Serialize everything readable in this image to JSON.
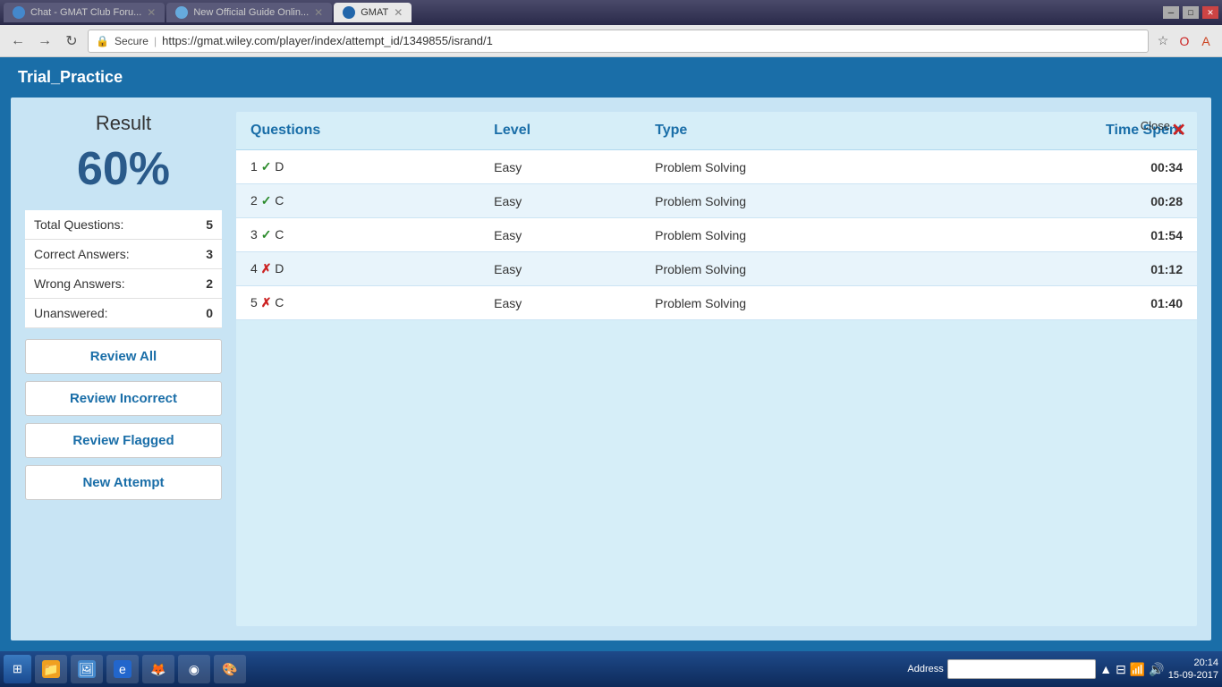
{
  "browser": {
    "tabs": [
      {
        "label": "Chat - GMAT Club Foru...",
        "active": false,
        "id": "tab-chat"
      },
      {
        "label": "New Official Guide Onlin...",
        "active": false,
        "id": "tab-og"
      },
      {
        "label": "GMAT",
        "active": true,
        "id": "tab-gmat"
      }
    ],
    "url": "https://gmat.wiley.com/player/index/attempt_id/1349855/isrand/1",
    "secure_label": "Secure"
  },
  "page": {
    "title": "Trial_Practice"
  },
  "result": {
    "label": "Result",
    "percentage": "60%"
  },
  "stats": [
    {
      "label": "Total Questions:",
      "value": "5"
    },
    {
      "label": "Correct Answers:",
      "value": "3"
    },
    {
      "label": "Wrong Answers:",
      "value": "2"
    },
    {
      "label": "Unanswered:",
      "value": "0"
    }
  ],
  "buttons": [
    {
      "label": "Review All",
      "id": "review-all"
    },
    {
      "label": "Review Incorrect",
      "id": "review-incorrect"
    },
    {
      "label": "Review Flagged",
      "id": "review-flagged"
    },
    {
      "label": "New Attempt",
      "id": "new-attempt"
    }
  ],
  "table": {
    "headers": [
      "Questions",
      "Level",
      "Type",
      "Time Spent"
    ],
    "close_label": "Close",
    "rows": [
      {
        "num": "1",
        "correct": true,
        "answer": "D",
        "level": "Easy",
        "type": "Problem Solving",
        "time": "00:34"
      },
      {
        "num": "2",
        "correct": true,
        "answer": "C",
        "level": "Easy",
        "type": "Problem Solving",
        "time": "00:28"
      },
      {
        "num": "3",
        "correct": true,
        "answer": "C",
        "level": "Easy",
        "type": "Problem Solving",
        "time": "01:54"
      },
      {
        "num": "4",
        "correct": false,
        "answer": "D",
        "level": "Easy",
        "type": "Problem Solving",
        "time": "01:12"
      },
      {
        "num": "5",
        "correct": false,
        "answer": "C",
        "level": "Easy",
        "type": "Problem Solving",
        "time": "01:40"
      }
    ]
  },
  "taskbar": {
    "time": "20:14",
    "date": "15-09-2017",
    "items": [
      {
        "icon": "⊞",
        "label": ""
      },
      {
        "icon": "📁",
        "label": ""
      },
      {
        "icon": "🖼",
        "label": ""
      },
      {
        "icon": "e",
        "label": ""
      },
      {
        "icon": "🦊",
        "label": ""
      },
      {
        "icon": "◉",
        "label": ""
      },
      {
        "icon": "🎨",
        "label": ""
      }
    ],
    "address_label": "Address"
  }
}
